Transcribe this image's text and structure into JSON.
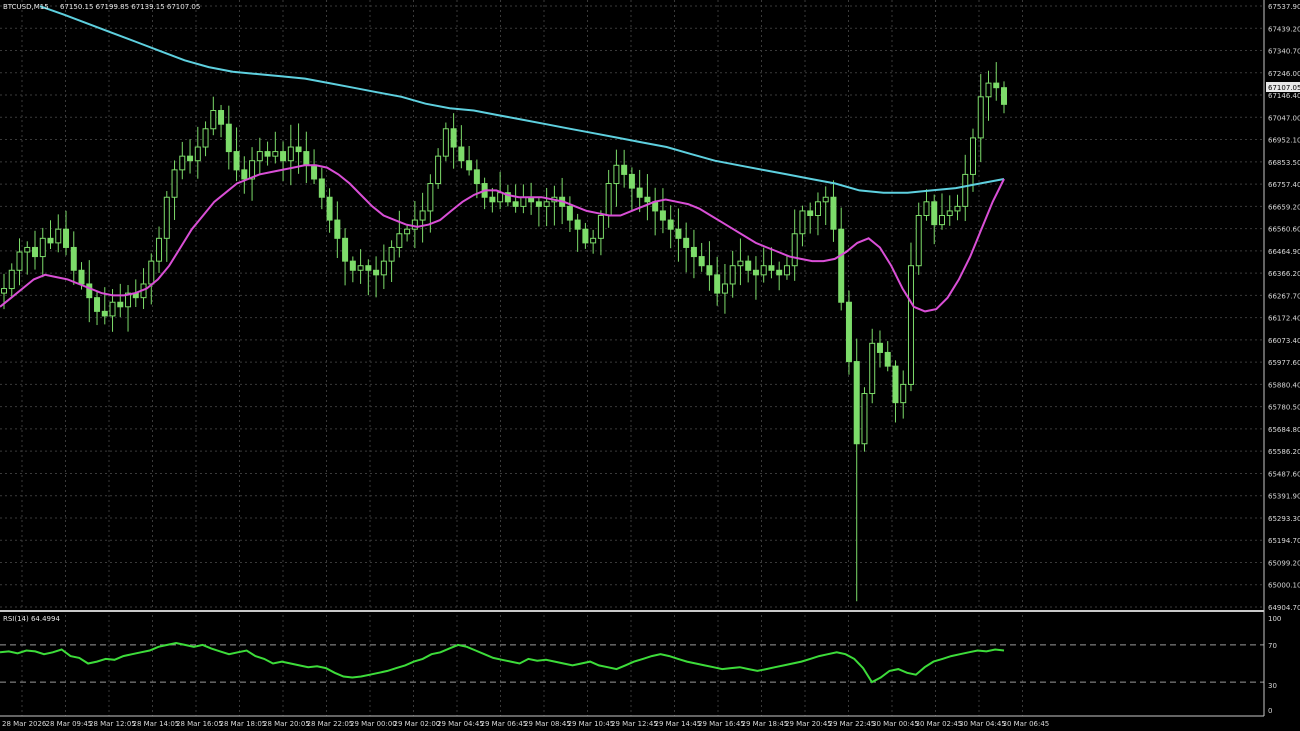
{
  "header": {
    "symbol": "BTCUSD,M15",
    "ohlc": "67150.15 67199.85 67139.15 67107.05",
    "current_price": "67107.05"
  },
  "rsi": {
    "label": "RSI(14) 64.4994",
    "levels": [
      "100",
      "70",
      "30",
      "0"
    ]
  },
  "colors": {
    "background": "#000000",
    "grid": "#3a3a3a",
    "candle": "#7ddc6a",
    "ma_slow": "#5ed0df",
    "ma_fast": "#d94fd6",
    "rsi": "#3ddc3a",
    "separator": "#c8c8c8"
  },
  "chart_data": {
    "type": "line",
    "title": "BTCUSD,M15",
    "y_ticks": [
      "67537.90",
      "67439.20",
      "67340.70",
      "67246.00",
      "67146.40",
      "67047.00",
      "66952.10",
      "66853.50",
      "66757.40",
      "66659.20",
      "66560.60",
      "66464.90",
      "66366.20",
      "66267.70",
      "66172.40",
      "66073.40",
      "65977.60",
      "65880.40",
      "65780.50",
      "65684.80",
      "65586.20",
      "65487.60",
      "65391.90",
      "65293.30",
      "65194.70",
      "65099.20",
      "65000.10",
      "64904.70"
    ],
    "ylim": [
      64904.7,
      67537.9
    ],
    "x_ticks": [
      "28 Mar 2026",
      "28 Mar 09:45",
      "28 Mar 12:05",
      "28 Mar 14:05",
      "28 Mar 16:05",
      "28 Mar 18:05",
      "28 Mar 20:05",
      "28 Mar 22:05",
      "29 Mar 00:00",
      "29 Mar 02:00",
      "29 Mar 04:45",
      "29 Mar 06:45",
      "29 Mar 08:45",
      "29 Mar 10:45",
      "29 Mar 12:45",
      "29 Mar 14:45",
      "29 Mar 16:45",
      "29 Mar 18:45",
      "29 Mar 20:45",
      "29 Mar 22:45",
      "30 Mar 00:45",
      "30 Mar 02:45",
      "30 Mar 04:45",
      "30 Mar 06:45"
    ],
    "close": [
      66300,
      66380,
      66460,
      66480,
      66440,
      66520,
      66500,
      66560,
      66480,
      66380,
      66320,
      66260,
      66200,
      66180,
      66240,
      66220,
      66280,
      66260,
      66320,
      66420,
      66520,
      66700,
      66820,
      66880,
      66860,
      66920,
      67000,
      67080,
      67020,
      66900,
      66820,
      66780,
      66860,
      66900,
      66880,
      66900,
      66860,
      66920,
      66900,
      66840,
      66780,
      66700,
      66600,
      66520,
      66420,
      66380,
      66400,
      66380,
      66360,
      66420,
      66480,
      66540,
      66560,
      66600,
      66640,
      66760,
      66880,
      67000,
      66920,
      66860,
      66820,
      66760,
      66700,
      66680,
      66720,
      66680,
      66660,
      66700,
      66680,
      66660,
      66680,
      66700,
      66660,
      66600,
      66560,
      66500,
      66520,
      66620,
      66760,
      66840,
      66800,
      66740,
      66700,
      66680,
      66640,
      66600,
      66560,
      66520,
      66480,
      66440,
      66400,
      66360,
      66280,
      66320,
      66400,
      66420,
      66380,
      66360,
      66400,
      66380,
      66360,
      66400,
      66540,
      66640,
      66620,
      66680,
      66700,
      66560,
      66240,
      65980,
      65620,
      65840,
      66060,
      66020,
      65960,
      65800,
      65880,
      66400,
      66620,
      66680,
      66580,
      66620,
      66640,
      66660,
      66800,
      66960,
      67140,
      67200,
      67180,
      67107
    ],
    "ma_fast": [
      66220,
      66260,
      66300,
      66340,
      66360,
      66350,
      66340,
      66320,
      66300,
      66280,
      66270,
      66270,
      66280,
      66300,
      66340,
      66400,
      66480,
      66560,
      66620,
      66680,
      66720,
      66760,
      66780,
      66800,
      66810,
      66820,
      66830,
      66840,
      66840,
      66830,
      66800,
      66760,
      66710,
      66660,
      66620,
      66600,
      66580,
      66570,
      66580,
      66600,
      66640,
      66680,
      66710,
      66730,
      66730,
      66710,
      66700,
      66700,
      66700,
      66690,
      66680,
      66660,
      66640,
      66630,
      66620,
      66620,
      66640,
      66660,
      66680,
      66690,
      66680,
      66670,
      66650,
      66620,
      66590,
      66560,
      66530,
      66500,
      66480,
      66460,
      66440,
      66430,
      66420,
      66420,
      66430,
      66460,
      66500,
      66520,
      66480,
      66400,
      66300,
      66220,
      66200,
      66210,
      66260,
      66340,
      66440,
      66560,
      66680,
      66780
    ],
    "ma_slow": [
      67537,
      67500,
      67460,
      67420,
      67380,
      67340,
      67300,
      67270,
      67250,
      67240,
      67230,
      67220,
      67200,
      67180,
      67160,
      67140,
      67110,
      67090,
      67080,
      67060,
      67040,
      67020,
      67000,
      66980,
      66960,
      66940,
      66920,
      66890,
      66860,
      66840,
      66820,
      66800,
      66780,
      66760,
      66730,
      66720,
      66720,
      66730,
      66740,
      66760,
      66780
    ],
    "rsi_values": [
      62,
      63,
      61,
      64,
      63,
      60,
      62,
      65,
      58,
      56,
      50,
      52,
      55,
      54,
      58,
      60,
      62,
      64,
      68,
      70,
      72,
      70,
      68,
      70,
      66,
      63,
      60,
      62,
      64,
      58,
      55,
      50,
      52,
      50,
      48,
      46,
      47,
      45,
      40,
      36,
      35,
      36,
      38,
      40,
      42,
      45,
      48,
      52,
      55,
      60,
      62,
      66,
      70,
      68,
      64,
      60,
      56,
      54,
      52,
      50,
      55,
      53,
      54,
      52,
      50,
      48,
      50,
      52,
      48,
      46,
      44,
      48,
      52,
      55,
      58,
      60,
      58,
      55,
      52,
      50,
      48,
      46,
      44,
      45,
      46,
      44,
      42,
      44,
      46,
      48,
      50,
      52,
      55,
      58,
      60,
      62,
      60,
      55,
      45,
      30,
      35,
      42,
      44,
      40,
      38,
      46,
      52,
      55,
      58,
      60,
      62,
      64,
      63,
      65,
      64
    ]
  }
}
